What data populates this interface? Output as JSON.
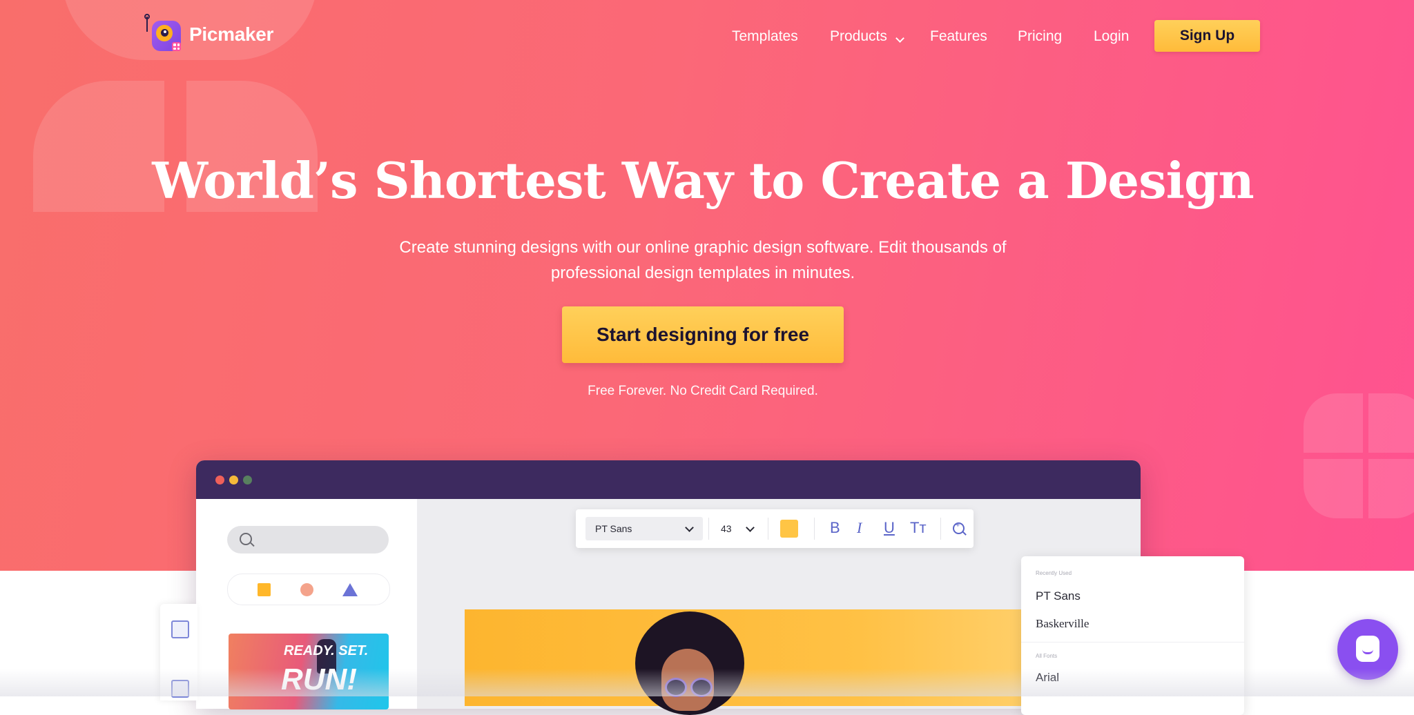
{
  "brand": {
    "name": "Picmaker",
    "accent": "#ffbb3a",
    "purple": "#8a4ff0"
  },
  "nav": {
    "items": [
      {
        "label": "Templates"
      },
      {
        "label": "Products"
      },
      {
        "label": "Features"
      },
      {
        "label": "Pricing"
      },
      {
        "label": "Login"
      }
    ],
    "signup_label": "Sign Up"
  },
  "hero": {
    "headline": "World’s Shortest Way to Create a Design",
    "subline": "Create stunning designs with our online graphic design software. Edit thousands of professional design templates in minutes.",
    "cta_label": "Start designing for free",
    "note": "Free Forever. No Credit Card Required."
  },
  "editor": {
    "sidebar": {
      "thumbnail_line1": "READY. SET.",
      "thumbnail_line2": "RUN!"
    },
    "toolbar": {
      "font_name": "PT Sans",
      "font_size": "43",
      "swatch_color": "#ffc545",
      "bold_label": "B",
      "italic_label": "I",
      "underline_label": "U",
      "case_label": "Tт"
    },
    "font_panel": {
      "recent_header": "Recently Used",
      "recent": [
        "PT Sans",
        "Baskerville"
      ],
      "all_header": "All Fonts",
      "all": [
        "Arial"
      ]
    }
  }
}
